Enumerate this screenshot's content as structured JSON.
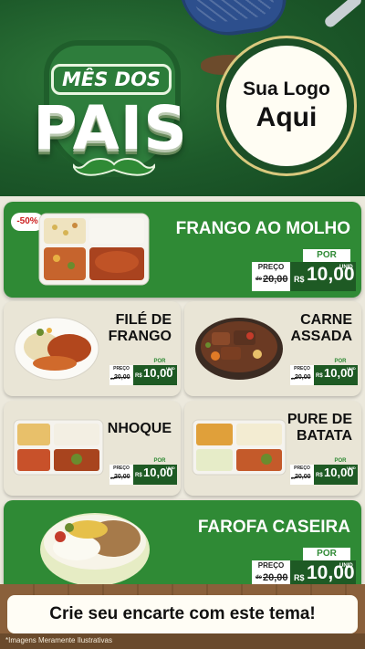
{
  "header": {
    "line1": "MÊS DOS",
    "line2": "PAIS",
    "logo_line1": "Sua Logo",
    "logo_line2": "Aqui"
  },
  "products": [
    {
      "name": "FRANGO AO MOLHO",
      "badge": "-50%",
      "por": "POR",
      "preco": "PREÇO",
      "de": "de",
      "old": "20,00",
      "currency": "R$",
      "price": "10,00",
      "unit": "UNID"
    },
    {
      "name_l1": "FILÉ DE",
      "name_l2": "FRANGO",
      "por": "POR",
      "preco": "PREÇO",
      "de": "de",
      "old": "20,00",
      "currency": "R$",
      "price": "10,00",
      "unit": "UNID"
    },
    {
      "name_l1": "CARNE",
      "name_l2": "ASSADA",
      "por": "POR",
      "preco": "PREÇO",
      "de": "de",
      "old": "20,00",
      "currency": "R$",
      "price": "10,00",
      "unit": "UNID"
    },
    {
      "name": "NHOQUE",
      "por": "POR",
      "preco": "PREÇO",
      "de": "de",
      "old": "20,00",
      "currency": "R$",
      "price": "10,00",
      "unit": "UNID"
    },
    {
      "name_l1": "PURE DE",
      "name_l2": "BATATA",
      "por": "POR",
      "preco": "PREÇO",
      "de": "de",
      "old": "20,00",
      "currency": "R$",
      "price": "10,00",
      "unit": "UNID"
    },
    {
      "name": "FAROFA CASEIRA",
      "por": "POR",
      "preco": "PREÇO",
      "de": "de",
      "old": "20,00",
      "currency": "R$",
      "price": "10,00",
      "unit": "UNID"
    }
  ],
  "banner": "Crie seu encarte com este tema!",
  "footnote": "*Imagens Meramente Ilustrativas",
  "colors": {
    "green": "#2f8a35",
    "dark_green": "#1e5a24",
    "cream": "#e9e5d6"
  }
}
